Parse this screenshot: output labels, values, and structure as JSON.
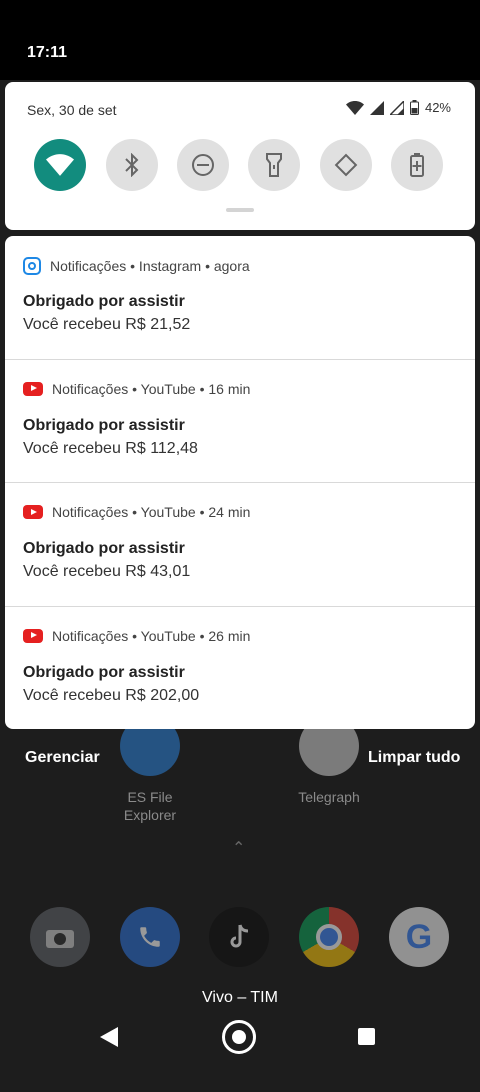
{
  "status_bar": {
    "time": "17:11"
  },
  "quick_settings": {
    "date": "Sex, 30 de set",
    "battery": "42%",
    "tiles": [
      {
        "name": "wifi",
        "active": true
      },
      {
        "name": "bluetooth",
        "active": false
      },
      {
        "name": "do-not-disturb",
        "active": false
      },
      {
        "name": "flashlight",
        "active": false
      },
      {
        "name": "auto-rotate",
        "active": false
      },
      {
        "name": "battery-saver",
        "active": false
      }
    ]
  },
  "notifications": [
    {
      "app_icon": "instagram-icon",
      "header": "Notificações • Instagram • agora",
      "title": "Obrigado por assistir",
      "text": "Você recebeu R$ 21,52"
    },
    {
      "app_icon": "youtube-icon",
      "header": "Notificações • YouTube • 16 min",
      "title": "Obrigado por assistir",
      "text": "Você recebeu R$ 112,48"
    },
    {
      "app_icon": "youtube-icon",
      "header": "Notificações • YouTube • 24 min",
      "title": "Obrigado por assistir",
      "text": "Você recebeu R$ 43,01"
    },
    {
      "app_icon": "youtube-icon",
      "header": "Notificações • YouTube • 26 min",
      "title": "Obrigado por assistir",
      "text": "Você recebeu R$ 202,00"
    }
  ],
  "shade_footer": {
    "manage": "Gerenciar",
    "clear_all": "Limpar tudo"
  },
  "home_apps": [
    {
      "label_line1": "ES File",
      "label_line2": "Explorer"
    },
    {
      "label_line1": "Telegraph",
      "label_line2": ""
    }
  ],
  "carrier": "Vivo – TIM",
  "colors": {
    "accent": "#128c7e",
    "youtube": "#e52020",
    "instagram": "#1e88e5"
  }
}
